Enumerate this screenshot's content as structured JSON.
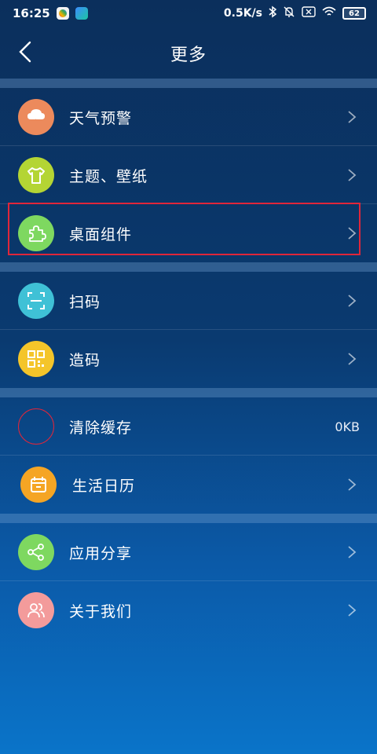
{
  "status": {
    "time": "16:25",
    "net_speed": "0.5K/s",
    "battery": "62"
  },
  "nav": {
    "title": "更多"
  },
  "colors": {
    "weather": "#ec8a5c",
    "theme": "#b4d534",
    "widget": "#7ed860",
    "scan": "#3fc1d6",
    "qrcode": "#f4c52a",
    "calendar": "#f5a524",
    "share": "#7ed860",
    "about": "#f39b9b",
    "highlight": "#e0263a"
  },
  "menu": {
    "weather_alert": "天气预警",
    "theme_wallpaper": "主题、壁纸",
    "desktop_widget": "桌面组件",
    "scan": "扫码",
    "make_code": "造码",
    "clear_cache": "清除缓存",
    "cache_size": "0KB",
    "life_calendar": "生活日历",
    "share_app": "应用分享",
    "about_us": "关于我们"
  }
}
